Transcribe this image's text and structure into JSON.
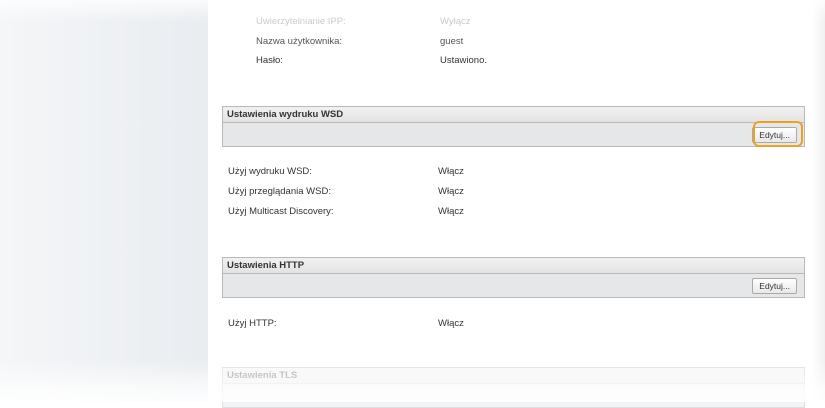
{
  "top_settings": [
    {
      "label": "Uwierzytelnianie IPP:",
      "value": "Wyłącz"
    },
    {
      "label": "Nazwa użytkownika:",
      "value": "guest"
    },
    {
      "label": "Hasło:",
      "value": "Ustawiono."
    }
  ],
  "wsd": {
    "header": "Ustawienia wydruku WSD",
    "edit_label": "Edytuj...",
    "rows": [
      {
        "label": "Użyj wydruku WSD:",
        "value": "Włącz"
      },
      {
        "label": "Użyj przeglądania WSD:",
        "value": "Włącz"
      },
      {
        "label": "Użyj Multicast Discovery:",
        "value": "Włącz"
      }
    ]
  },
  "http": {
    "header": "Ustawienia HTTP",
    "edit_label": "Edytuj...",
    "rows": [
      {
        "label": "Użyj HTTP:",
        "value": "Włącz"
      }
    ]
  },
  "tls": {
    "header": "Ustawienia TLS"
  },
  "colors": {
    "highlight": "#f0a01e",
    "section_bar": "#e6e7e9",
    "section_border": "#b9b9b9"
  }
}
